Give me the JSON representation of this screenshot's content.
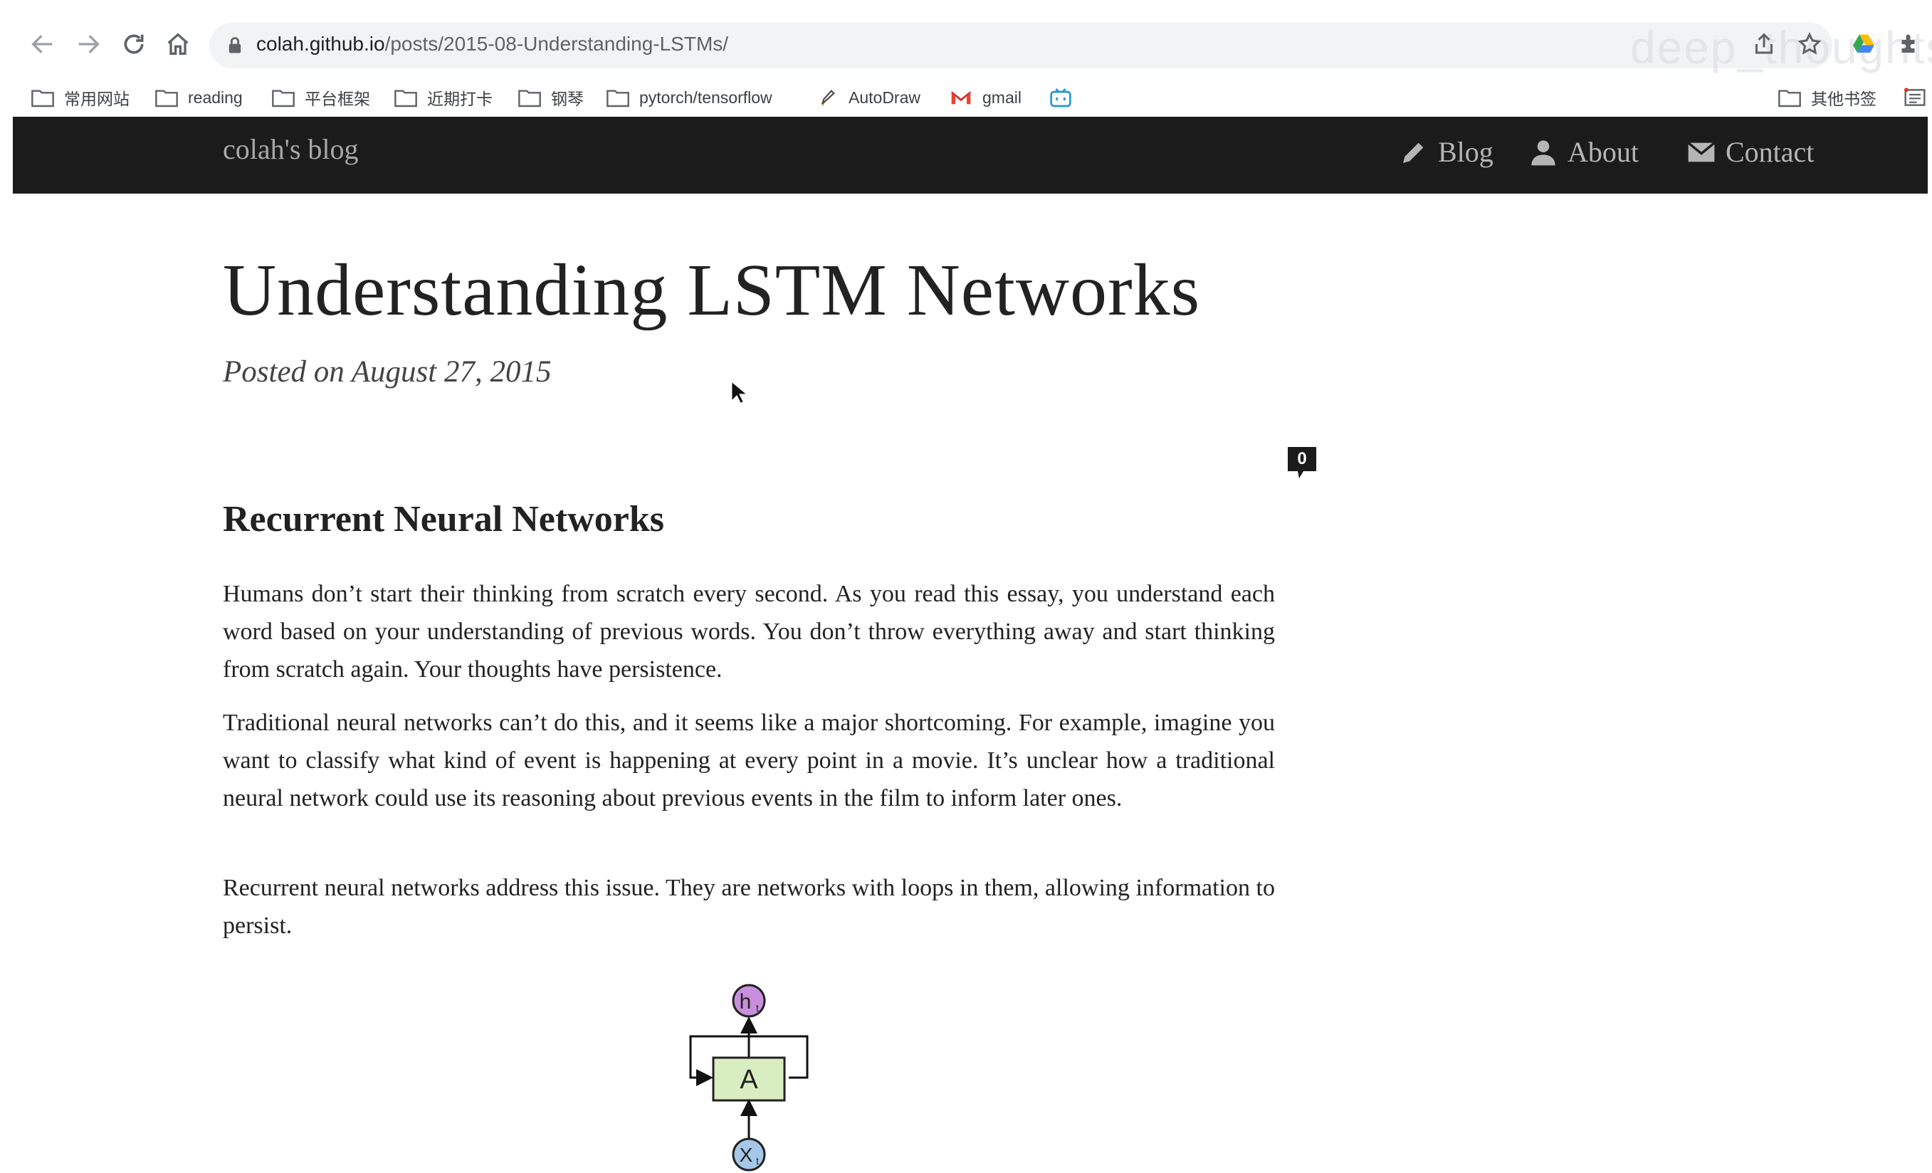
{
  "browser": {
    "url_host": "colah.github.io",
    "url_path": "/posts/2015-08-Understanding-LSTMs/",
    "watermark": "deep_thoughts",
    "bookmarks": [
      {
        "label": "常用网站",
        "icon": "folder-icon"
      },
      {
        "label": "reading",
        "icon": "folder-icon"
      },
      {
        "label": "平台框架",
        "icon": "folder-icon"
      },
      {
        "label": "近期打卡",
        "icon": "folder-icon"
      },
      {
        "label": "钢琴",
        "icon": "folder-icon"
      },
      {
        "label": "pytorch/tensorflow",
        "icon": "folder-icon"
      },
      {
        "label": "AutoDraw",
        "icon": "autodraw-icon"
      },
      {
        "label": "gmail",
        "icon": "gmail-icon"
      },
      {
        "label": "",
        "icon": "bilibili-icon"
      }
    ],
    "other_bookmarks": "其他书签"
  },
  "site": {
    "title": "colah's blog",
    "nav": {
      "blog": "Blog",
      "about": "About",
      "contact": "Contact"
    }
  },
  "post": {
    "title": "Understanding LSTM Networks",
    "meta": "Posted on August 27, 2015",
    "comment_count": "0",
    "section_heading": "Recurrent Neural Networks",
    "paragraphs": [
      "Humans don’t start their thinking from scratch every second. As you read this essay, you understand each word based on your understanding of previous words. You don’t throw everything away and start thinking from scratch again. Your thoughts have persistence.",
      "Traditional neural networks can’t do this, and it seems like a major shortcoming. For example, imagine you want to classify what kind of event is happening at every point in a movie. It’s unclear how a traditional neural network could use its reasoning about previous events in the film to inform later ones.",
      "Recurrent neural networks address this issue. They are networks with loops in them, allowing information to persist."
    ],
    "diagram": {
      "cell_label": "A",
      "output_label": "h",
      "output_subscript": "t",
      "input_label": "X",
      "input_subscript": "t"
    }
  },
  "colors": {
    "header_bg": "#1b1b1b",
    "cell_fill": "#d8eec0",
    "output_fill": "#c890dc",
    "input_fill": "#a6c8e8"
  }
}
